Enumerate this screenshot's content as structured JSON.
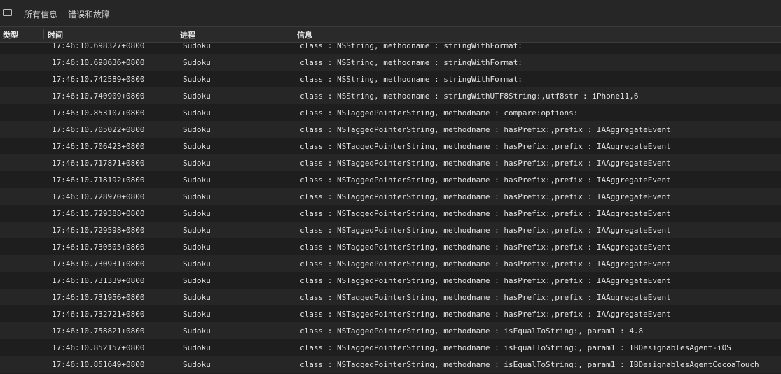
{
  "toolbar": {
    "tabs": [
      "所有信息",
      "错误和故障"
    ]
  },
  "columns": {
    "type": "类型",
    "time": "时间",
    "process": "进程",
    "info": "信息"
  },
  "rows": [
    {
      "time": "17:46:10.698327+0800",
      "process": "Sudoku",
      "info": "class : NSString, methodname : stringWithFormat:"
    },
    {
      "time": "17:46:10.698636+0800",
      "process": "Sudoku",
      "info": "class : NSString, methodname : stringWithFormat:"
    },
    {
      "time": "17:46:10.742589+0800",
      "process": "Sudoku",
      "info": "class : NSString, methodname : stringWithFormat:"
    },
    {
      "time": "17:46:10.740909+0800",
      "process": "Sudoku",
      "info": "class : NSString, methodname : stringWithUTF8String:,utf8str : iPhone11,6"
    },
    {
      "time": "17:46:10.853107+0800",
      "process": "Sudoku",
      "info": "class : NSTaggedPointerString, methodname : compare:options:"
    },
    {
      "time": "17:46:10.705022+0800",
      "process": "Sudoku",
      "info": "class : NSTaggedPointerString, methodname : hasPrefix:,prefix : IAAggregateEvent"
    },
    {
      "time": "17:46:10.706423+0800",
      "process": "Sudoku",
      "info": "class : NSTaggedPointerString, methodname : hasPrefix:,prefix : IAAggregateEvent"
    },
    {
      "time": "17:46:10.717871+0800",
      "process": "Sudoku",
      "info": "class : NSTaggedPointerString, methodname : hasPrefix:,prefix : IAAggregateEvent"
    },
    {
      "time": "17:46:10.718192+0800",
      "process": "Sudoku",
      "info": "class : NSTaggedPointerString, methodname : hasPrefix:,prefix : IAAggregateEvent"
    },
    {
      "time": "17:46:10.728970+0800",
      "process": "Sudoku",
      "info": "class : NSTaggedPointerString, methodname : hasPrefix:,prefix : IAAggregateEvent"
    },
    {
      "time": "17:46:10.729388+0800",
      "process": "Sudoku",
      "info": "class : NSTaggedPointerString, methodname : hasPrefix:,prefix : IAAggregateEvent"
    },
    {
      "time": "17:46:10.729598+0800",
      "process": "Sudoku",
      "info": "class : NSTaggedPointerString, methodname : hasPrefix:,prefix : IAAggregateEvent"
    },
    {
      "time": "17:46:10.730505+0800",
      "process": "Sudoku",
      "info": "class : NSTaggedPointerString, methodname : hasPrefix:,prefix : IAAggregateEvent"
    },
    {
      "time": "17:46:10.730931+0800",
      "process": "Sudoku",
      "info": "class : NSTaggedPointerString, methodname : hasPrefix:,prefix : IAAggregateEvent"
    },
    {
      "time": "17:46:10.731339+0800",
      "process": "Sudoku",
      "info": "class : NSTaggedPointerString, methodname : hasPrefix:,prefix : IAAggregateEvent"
    },
    {
      "time": "17:46:10.731956+0800",
      "process": "Sudoku",
      "info": "class : NSTaggedPointerString, methodname : hasPrefix:,prefix : IAAggregateEvent"
    },
    {
      "time": "17:46:10.732721+0800",
      "process": "Sudoku",
      "info": "class : NSTaggedPointerString, methodname : hasPrefix:,prefix : IAAggregateEvent"
    },
    {
      "time": "17:46:10.758821+0800",
      "process": "Sudoku",
      "info": "class : NSTaggedPointerString, methodname : isEqualToString:, param1 : 4.8"
    },
    {
      "time": "17:46:10.852157+0800",
      "process": "Sudoku",
      "info": "class : NSTaggedPointerString, methodname : isEqualToString:, param1 : IBDesignablesAgent-iOS"
    },
    {
      "time": "17:46:10.851649+0800",
      "process": "Sudoku",
      "info": "class : NSTaggedPointerString, methodname : isEqualToString:, param1 : IBDesignablesAgentCocoaTouch"
    }
  ]
}
